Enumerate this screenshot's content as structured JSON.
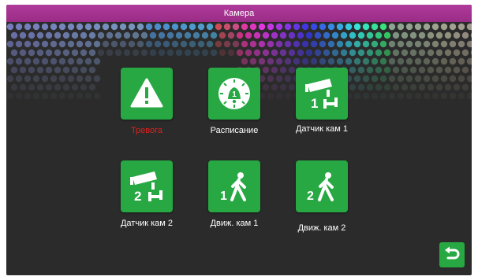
{
  "window": {
    "title": "Камера"
  },
  "colors": {
    "title_bar": "#a1318d",
    "tile": "#27a843",
    "active_label": "#e0201c"
  },
  "tiles": [
    {
      "label": "Тревога",
      "icon": "warning-triangle-icon",
      "active": true
    },
    {
      "label": "Расписание",
      "icon": "schedule-clock-bell-icon"
    },
    {
      "label": "Датчик кам 1",
      "icon": "camera-sensor-1-icon"
    },
    {
      "label": "Датчик кам 2",
      "icon": "camera-sensor-2-icon"
    },
    {
      "label": "Движ. кам 1",
      "icon": "motion-camera-1-icon"
    },
    {
      "label": "Движ. кам 2",
      "icon": "motion-camera-2-icon"
    }
  ],
  "back_button": {
    "icon": "return-arrow-icon"
  }
}
